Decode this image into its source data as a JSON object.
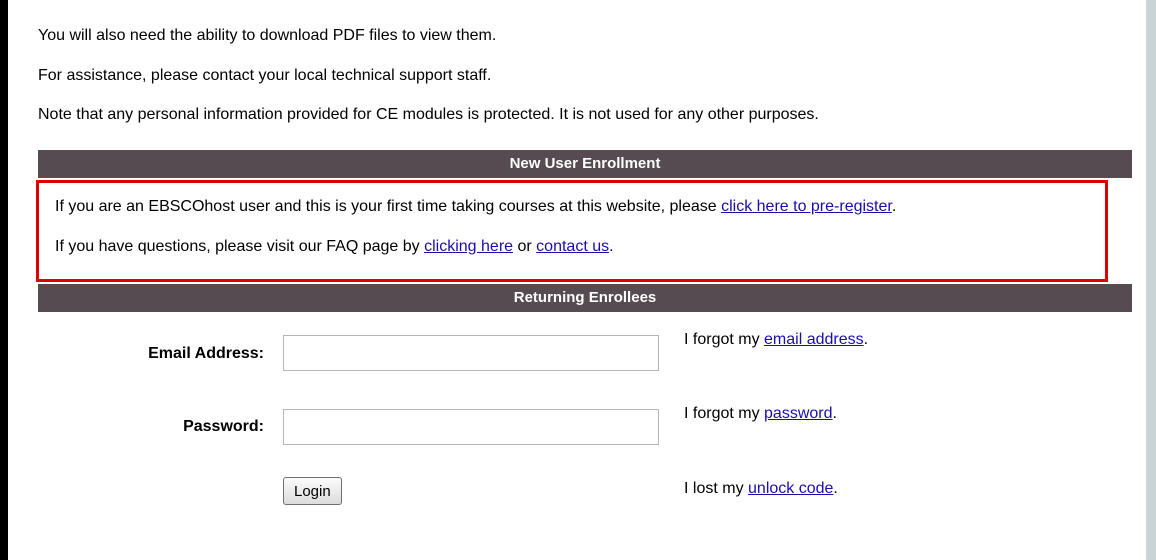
{
  "intro": {
    "line1": "You will also need the ability to download PDF files to view them.",
    "line2": "For assistance, please contact your local technical support staff.",
    "line3": "Note that any personal information provided for CE modules is protected. It is not used for any other purposes."
  },
  "new_user": {
    "header": "New User Enrollment",
    "line1_text": "If you are an EBSCOhost user and this is your first time taking courses at this website, please ",
    "line1_link": "click here to pre-register",
    "line1_end": ".",
    "line2_text": "If you have questions, please visit our FAQ page by ",
    "line2_link1": "clicking here",
    "line2_mid": " or ",
    "line2_link2": "contact us",
    "line2_end": "."
  },
  "returning": {
    "header": "Returning Enrollees",
    "email_label": "Email Address:",
    "email_value": "",
    "password_label": "Password:",
    "password_value": "",
    "login_label": "Login",
    "forgot_email_text": "I forgot my ",
    "forgot_email_link": "email address",
    "forgot_password_text": "I forgot my ",
    "forgot_password_link": "password",
    "lost_unlock_text": "I lost my ",
    "lost_unlock_link": "unlock code",
    "period": "."
  },
  "colors": {
    "header_bg": "#554b50",
    "highlight_border": "#e00000",
    "link": "#1a0dab",
    "side_bg": "#c9d4d6"
  }
}
